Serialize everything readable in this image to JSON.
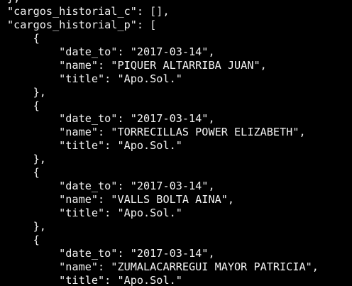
{
  "terminal": {
    "lines": [
      "},",
      "\"cargos_historial_c\": [],",
      "\"cargos_historial_p\": [",
      "    {",
      "        \"date_to\": \"2017-03-14\",",
      "        \"name\": \"PIQUER ALTARRIBA JUAN\",",
      "        \"title\": \"Apo.Sol.\"",
      "    },",
      "    {",
      "        \"date_to\": \"2017-03-14\",",
      "        \"name\": \"TORRECILLAS POWER ELIZABETH\",",
      "        \"title\": \"Apo.Sol.\"",
      "    },",
      "    {",
      "        \"date_to\": \"2017-03-14\",",
      "        \"name\": \"VALLS BOLTA AINA\",",
      "        \"title\": \"Apo.Sol.\"",
      "    },",
      "    {",
      "        \"date_to\": \"2017-03-14\",",
      "        \"name\": \"ZUMALACARREGUI MAYOR PATRICIA\",",
      "        \"title\": \"Apo.Sol.\""
    ]
  }
}
